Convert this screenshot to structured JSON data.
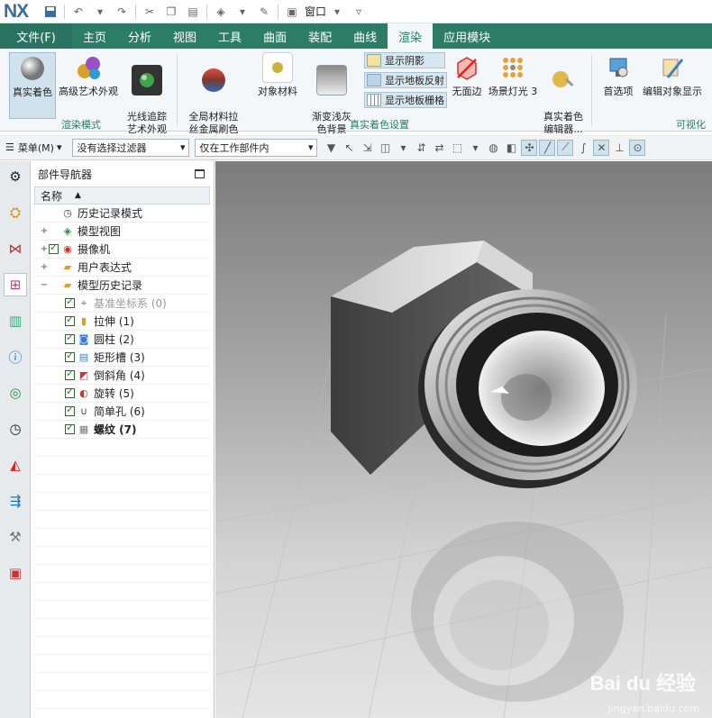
{
  "app": {
    "logo": "NX",
    "window_menu": "窗口"
  },
  "tabs": {
    "file": "文件(F)",
    "items": [
      "主页",
      "分析",
      "视图",
      "工具",
      "曲面",
      "装配",
      "曲线",
      "渲染",
      "应用模块"
    ],
    "active": "渲染"
  },
  "ribbon": {
    "buttons": [
      {
        "label": "真实着色",
        "icon": "shaded-sphere-icon"
      },
      {
        "label": "高级艺术外观",
        "icon": "spheres-icon"
      },
      {
        "label": "光线追踪\n艺术外观",
        "icon": "ray-trace-icon"
      },
      {
        "label": "全局材料拉\n丝金属刷色",
        "icon": "material-sphere-icon"
      },
      {
        "label": "对象材料",
        "icon": "object-material-icon"
      },
      {
        "label": "渐变浅灰\n色背景",
        "icon": "gradient-background-icon"
      },
      {
        "label": "无面边",
        "icon": "no-face-edges-icon"
      },
      {
        "label": "场景灯光 3",
        "icon": "scene-lights-icon"
      },
      {
        "label": "真实着色\n编辑器...",
        "icon": "shading-editor-icon"
      },
      {
        "label": "首选项",
        "icon": "preferences-icon"
      },
      {
        "label": "编辑对象显示",
        "icon": "edit-object-display-icon"
      }
    ],
    "small_buttons": [
      "显示阴影",
      "显示地板反射",
      "显示地板栅格"
    ],
    "groups": {
      "render_mode": "渲染模式",
      "true_shading": "真实着色设置",
      "visualization": "可视化"
    }
  },
  "filterbar": {
    "menu": "菜单(M)",
    "filter": "没有选择过滤器",
    "scope": "仅在工作部件内"
  },
  "navigator": {
    "title": "部件导航器",
    "column": "名称",
    "rows": [
      {
        "label": "历史记录模式",
        "icon": "clock-icon",
        "exp": "",
        "check": false,
        "style": ""
      },
      {
        "label": "模型视图",
        "icon": "model-view-icon",
        "exp": "+",
        "check": false,
        "style": ""
      },
      {
        "label": "摄像机",
        "icon": "camera-icon",
        "exp": "+",
        "check": true,
        "style": ""
      },
      {
        "label": "用户表达式",
        "icon": "folder-icon",
        "exp": "+",
        "check": false,
        "style": ""
      },
      {
        "label": "模型历史记录",
        "icon": "folder-open-icon",
        "exp": "−",
        "check": false,
        "style": ""
      },
      {
        "label": "基准坐标系 (0)",
        "icon": "datum-csys-icon",
        "exp": "",
        "check": true,
        "style": "dim"
      },
      {
        "label": "拉伸 (1)",
        "icon": "extrude-icon",
        "exp": "",
        "check": true,
        "style": ""
      },
      {
        "label": "圆柱 (2)",
        "icon": "cylinder-icon",
        "exp": "",
        "check": true,
        "style": ""
      },
      {
        "label": "矩形槽 (3)",
        "icon": "groove-icon",
        "exp": "",
        "check": true,
        "style": ""
      },
      {
        "label": "倒斜角 (4)",
        "icon": "chamfer-icon",
        "exp": "",
        "check": true,
        "style": ""
      },
      {
        "label": "旋转 (5)",
        "icon": "revolve-icon",
        "exp": "",
        "check": true,
        "style": ""
      },
      {
        "label": "简单孔 (6)",
        "icon": "hole-icon",
        "exp": "",
        "check": true,
        "style": ""
      },
      {
        "label": "螺纹 (7)",
        "icon": "thread-icon",
        "exp": "",
        "check": true,
        "style": "bold"
      }
    ]
  },
  "watermark": {
    "brand": "Bai du 经验",
    "url": "jingyan.baidu.com"
  }
}
